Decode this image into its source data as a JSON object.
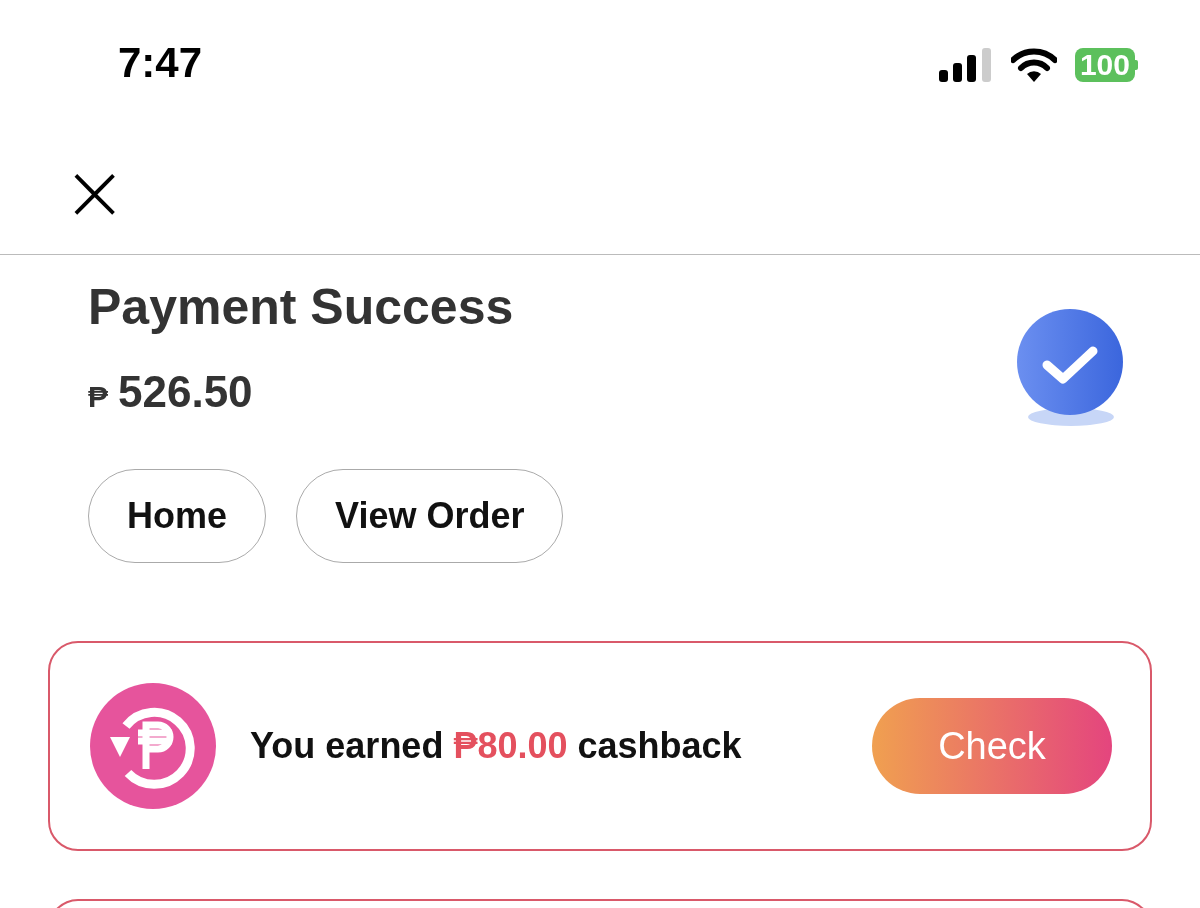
{
  "status_bar": {
    "time": "7:47",
    "battery": "100"
  },
  "header": {
    "close": "×"
  },
  "payment": {
    "title": "Payment Success",
    "currency": "₱",
    "amount": "526.50"
  },
  "buttons": [
    {
      "label": "Home"
    },
    {
      "label": "View Order"
    }
  ],
  "cashback": {
    "before": "You earned",
    "amount": "₱80.00",
    "after": "cashback",
    "button": "Check"
  }
}
